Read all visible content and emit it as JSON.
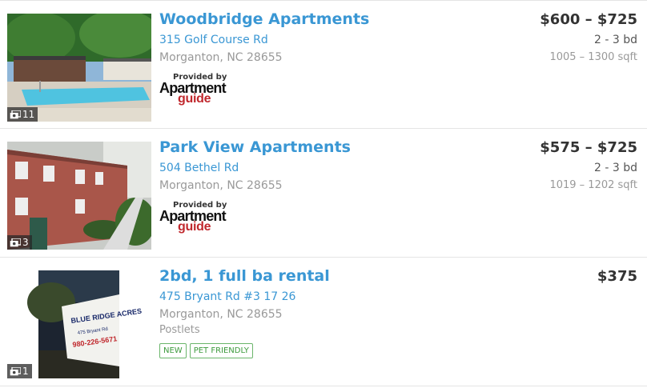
{
  "listings": [
    {
      "title": "Woodbridge Apartments",
      "address": "315 Golf Course Rd",
      "city": "Morganton, NC 28655",
      "price": "$600 – $725",
      "beds": "2 - 3 bd",
      "sqft": "1005 – 1300 sqft",
      "photo_count": "11",
      "provider": {
        "provided_by": "Provided by",
        "brand_line1": "Apartment",
        "brand_line2": "guide"
      }
    },
    {
      "title": "Park View Apartments",
      "address": "504 Bethel Rd",
      "city": "Morganton, NC 28655",
      "price": "$575 – $725",
      "beds": "2 - 3 bd",
      "sqft": "1019 – 1202 sqft",
      "photo_count": "3",
      "provider": {
        "provided_by": "Provided by",
        "brand_line1": "Apartment",
        "brand_line2": "guide"
      }
    },
    {
      "title": "2bd, 1 full ba rental",
      "address": "475 Bryant Rd #3 17 26",
      "city": "Morganton, NC 28655",
      "source": "Postlets",
      "price": "$375",
      "photo_count": "1",
      "tags": [
        "NEW",
        "PET FRIENDLY"
      ],
      "sign_text": [
        "BLUE RIDGE ACRES",
        "475 Bryant Rd",
        "980-226-5671"
      ]
    }
  ],
  "colors": {
    "link": "#3a97d4",
    "tag_green": "#3c9a3c",
    "brand_red": "#c0282d"
  }
}
